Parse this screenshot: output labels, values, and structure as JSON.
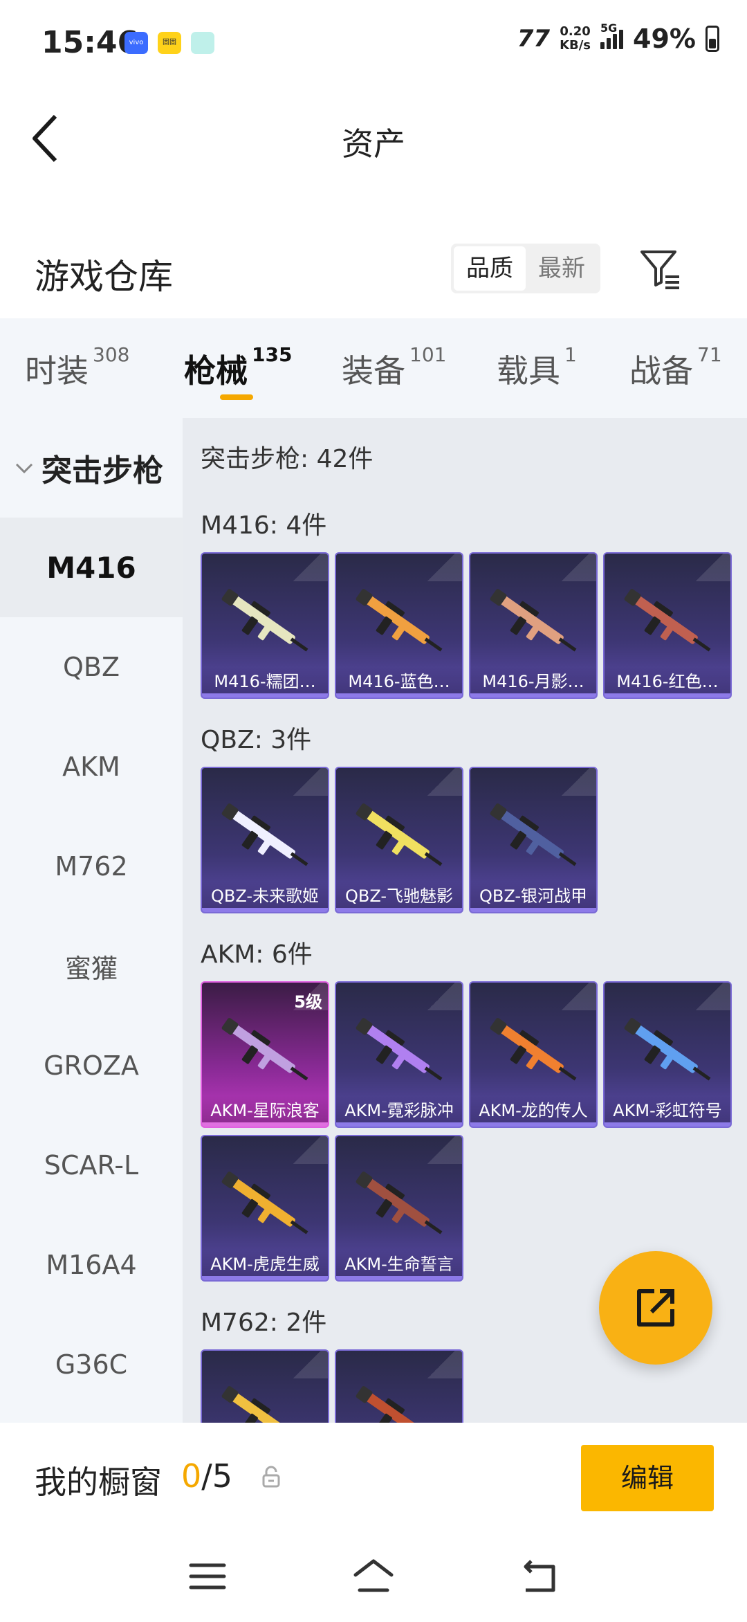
{
  "status_bar": {
    "time": "15:46",
    "app_icons": [
      "vivo",
      "固固",
      "chat"
    ],
    "speed_value": "0.20",
    "speed_unit": "KB/s",
    "network": "5G",
    "battery_percent": "49%",
    "battery_level": 0.49
  },
  "header": {
    "title": "资产"
  },
  "warehouse": {
    "title": "游戏仓库",
    "sort_options": [
      "品质",
      "最新"
    ],
    "sort_active": "品质"
  },
  "tabs": [
    {
      "label": "时装",
      "count": "308"
    },
    {
      "label": "枪械",
      "count": "135",
      "active": true
    },
    {
      "label": "装备",
      "count": "101"
    },
    {
      "label": "载具",
      "count": "1"
    },
    {
      "label": "战备",
      "count": "71"
    }
  ],
  "sidebar": {
    "category": "突击步枪",
    "items": [
      "M416",
      "QBZ",
      "AKM",
      "M762",
      "蜜獾",
      "GROZA",
      "SCAR-L",
      "M16A4",
      "G36C"
    ],
    "active": "M416"
  },
  "content": {
    "total": "突击步枪: 42件",
    "groups": [
      {
        "title": "M416: 4件",
        "items": [
          {
            "name": "M416-糯团…",
            "color": "#e6e6c0"
          },
          {
            "name": "M416-蓝色…",
            "color": "#f0a040"
          },
          {
            "name": "M416-月影…",
            "color": "#e0a080"
          },
          {
            "name": "M416-红色…",
            "color": "#c06050"
          }
        ]
      },
      {
        "title": "QBZ: 3件",
        "items": [
          {
            "name": "QBZ-未来歌姬",
            "color": "#f0f0ff"
          },
          {
            "name": "QBZ-飞驰魅影",
            "color": "#f0e060"
          },
          {
            "name": "QBZ-银河战甲",
            "color": "#5060a0"
          }
        ]
      },
      {
        "title": "AKM: 6件",
        "items": [
          {
            "name": "AKM-星际浪客",
            "color": "#c0a0e0",
            "level": "5级",
            "rarity": "pink"
          },
          {
            "name": "AKM-霓彩脉冲",
            "color": "#b080f0"
          },
          {
            "name": "AKM-龙的传人",
            "color": "#f08030"
          },
          {
            "name": "AKM-彩虹符号",
            "color": "#60a0f0"
          },
          {
            "name": "AKM-虎虎生威",
            "color": "#f0b030"
          },
          {
            "name": "AKM-生命誓言",
            "color": "#a05040"
          }
        ]
      },
      {
        "title": "M762: 2件",
        "items": [
          {
            "name": "",
            "color": "#f0c040"
          },
          {
            "name": "",
            "color": "#c05030"
          }
        ]
      }
    ]
  },
  "bottom_bar": {
    "showcase_label": "我的橱窗",
    "showcase_current": "0",
    "showcase_total": "/5",
    "edit_label": "编辑"
  },
  "colors": {
    "accent": "#f5a800",
    "card_purple": "#3d3673",
    "card_pink": "#8a2a96"
  },
  "icons": [
    "back-arrow-icon",
    "filter-icon",
    "chevron-down-icon",
    "share-icon",
    "lock-icon",
    "menu-icon",
    "home-icon",
    "return-icon"
  ]
}
